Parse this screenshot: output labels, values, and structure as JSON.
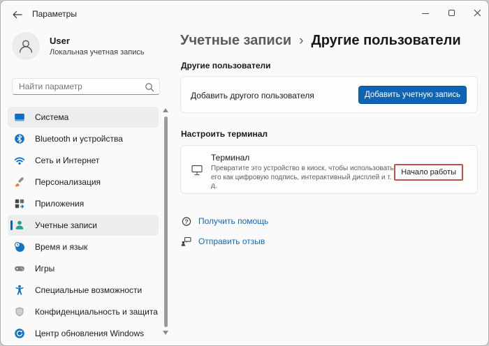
{
  "window": {
    "title": "Параметры"
  },
  "user": {
    "name": "User",
    "type": "Локальная учетная запись"
  },
  "search": {
    "placeholder": "Найти параметр"
  },
  "sidebar": {
    "nav": [
      {
        "label": "Система"
      },
      {
        "label": "Bluetooth и устройства"
      },
      {
        "label": "Сеть и Интернет"
      },
      {
        "label": "Персонализация"
      },
      {
        "label": "Приложения"
      },
      {
        "label": "Учетные записи"
      },
      {
        "label": "Время и язык"
      },
      {
        "label": "Игры"
      },
      {
        "label": "Специальные возможности"
      },
      {
        "label": "Конфиденциальность и защита"
      },
      {
        "label": "Центр обновления Windows"
      }
    ],
    "selected_index": 5
  },
  "breadcrumb": {
    "parent": "Учетные записи",
    "separator": "›",
    "current": "Другие пользователи"
  },
  "sections": {
    "other_users": {
      "title": "Другие пользователи",
      "row_label": "Добавить другого пользователя",
      "button": "Добавить учетную запись"
    },
    "kiosk": {
      "title": "Настроить терминал",
      "item_title": "Терминал",
      "description": "Превратите это устройство в киоск, чтобы использовать его как цифровую подпись, интерактивный дисплей и т. д.",
      "button": "Начало работы"
    }
  },
  "links": {
    "help": "Получить помощь",
    "feedback": "Отправить отзыв"
  },
  "colors": {
    "accent": "#0F64B4",
    "highlight": "#C0504D",
    "link": "#1466B8"
  }
}
